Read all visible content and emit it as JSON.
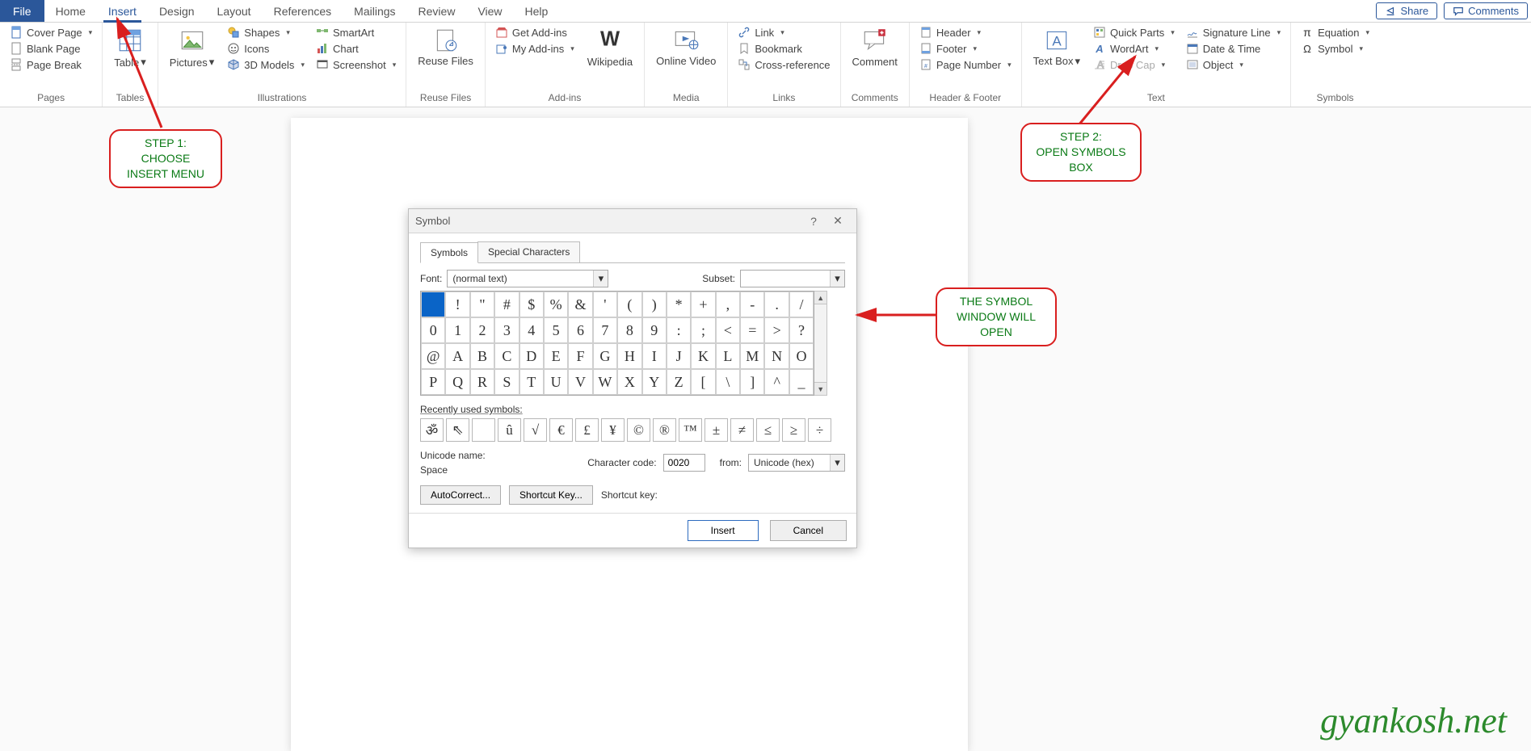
{
  "tabs": {
    "file": "File",
    "home": "Home",
    "insert": "Insert",
    "design": "Design",
    "layout": "Layout",
    "references": "References",
    "mailings": "Mailings",
    "review": "Review",
    "view": "View",
    "help": "Help",
    "share": "Share",
    "comments": "Comments",
    "active": "insert"
  },
  "ribbon": {
    "pages": {
      "label": "Pages",
      "cover": "Cover Page",
      "blank": "Blank Page",
      "break": "Page Break"
    },
    "tables": {
      "label": "Tables",
      "table": "Table"
    },
    "illus": {
      "label": "Illustrations",
      "pictures": "Pictures",
      "shapes": "Shapes",
      "icons": "Icons",
      "models3d": "3D Models",
      "smartart": "SmartArt",
      "chart": "Chart",
      "screenshot": "Screenshot"
    },
    "reuse": {
      "label": "Reuse Files",
      "reuse": "Reuse Files"
    },
    "addins": {
      "label": "Add-ins",
      "get": "Get Add-ins",
      "my": "My Add-ins",
      "wiki": "Wikipedia"
    },
    "media": {
      "label": "Media",
      "online": "Online Video"
    },
    "links": {
      "label": "Links",
      "link": "Link",
      "bookmark": "Bookmark",
      "crossref": "Cross-reference"
    },
    "comments": {
      "label": "Comments",
      "comment": "Comment"
    },
    "hf": {
      "label": "Header & Footer",
      "header": "Header",
      "footer": "Footer",
      "pagenum": "Page Number"
    },
    "text": {
      "label": "Text",
      "textbox": "Text Box",
      "quick": "Quick Parts",
      "wordart": "WordArt",
      "dropcap": "Drop Cap",
      "sigline": "Signature Line",
      "datetime": "Date & Time",
      "object": "Object"
    },
    "symbols": {
      "label": "Symbols",
      "equation": "Equation",
      "symbol": "Symbol"
    }
  },
  "dialog": {
    "title": "Symbol",
    "tabs": {
      "symbols": "Symbols",
      "special": "Special Characters"
    },
    "font_label": "Font:",
    "font_value": "(normal text)",
    "subset_label": "Subset:",
    "subset_value": "",
    "grid": [
      " ",
      "!",
      "\"",
      "#",
      "$",
      "%",
      "&",
      "'",
      "(",
      ")",
      "*",
      "+",
      ",",
      "-",
      ".",
      "/",
      "0",
      "1",
      "2",
      "3",
      "4",
      "5",
      "6",
      "7",
      "8",
      "9",
      ":",
      ";",
      "<",
      "=",
      ">",
      "?",
      "@",
      "A",
      "B",
      "C",
      "D",
      "E",
      "F",
      "G",
      "H",
      "I",
      "J",
      "K",
      "L",
      "M",
      "N",
      "O",
      "P",
      "Q",
      "R",
      "S",
      "T",
      "U",
      "V",
      "W",
      "X",
      "Y",
      "Z",
      "[",
      "\\",
      "]",
      "^",
      "_"
    ],
    "recent_label": "Recently used symbols:",
    "recent": [
      "ॐ",
      "⇖",
      "",
      "û",
      "√",
      "€",
      "£",
      "¥",
      "©",
      "®",
      "™",
      "±",
      "≠",
      "≤",
      "≥",
      "÷"
    ],
    "unicode_name_lbl": "Unicode name:",
    "unicode_name": "Space",
    "charcode_lbl": "Character code:",
    "charcode": "0020",
    "from_lbl": "from:",
    "from_val": "Unicode (hex)",
    "autocorrect": "AutoCorrect...",
    "shortcutkey_btn": "Shortcut Key...",
    "shortcutkey_lbl": "Shortcut key:",
    "insert": "Insert",
    "cancel": "Cancel",
    "help": "?",
    "close": "✕"
  },
  "callouts": {
    "step1": "STEP 1:\nCHOOSE\nINSERT MENU",
    "step2": "STEP 2:\nOPEN SYMBOLS\nBOX",
    "step3": "THE SYMBOL\nWINDOW WILL\nOPEN"
  },
  "watermark": "gyankosh.net"
}
